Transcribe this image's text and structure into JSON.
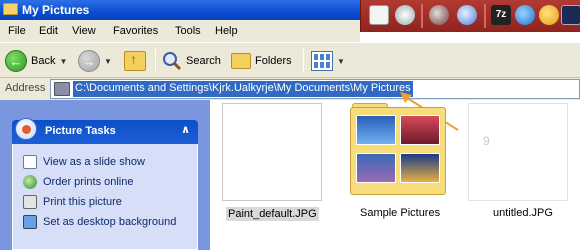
{
  "window": {
    "title": "My Pictures"
  },
  "menu": [
    "File",
    "Edit",
    "View",
    "Favorites",
    "Tools",
    "Help"
  ],
  "toolbar": {
    "back_label": "Back",
    "search_label": "Search",
    "folders_label": "Folders"
  },
  "address": {
    "label": "Address",
    "value": "C:\\Documents and Settings\\Kjrk.Ualkyrje\\My Documents\\My Pictures"
  },
  "task_pane": {
    "title": "Picture Tasks",
    "tasks": [
      {
        "label": "View as a slide show",
        "icon": "slideshow-icon"
      },
      {
        "label": "Order prints online",
        "icon": "globe-icon"
      },
      {
        "label": "Print this picture",
        "icon": "printer-icon"
      },
      {
        "label": "Set as desktop background",
        "icon": "desktop-icon"
      }
    ]
  },
  "files": [
    {
      "name": "Paint_default.JPG",
      "selected": true
    },
    {
      "name": "Sample Pictures",
      "type": "folder"
    },
    {
      "name": "untitled.JPG"
    }
  ],
  "annotation": {
    "arrow_color": "#f0a030"
  }
}
